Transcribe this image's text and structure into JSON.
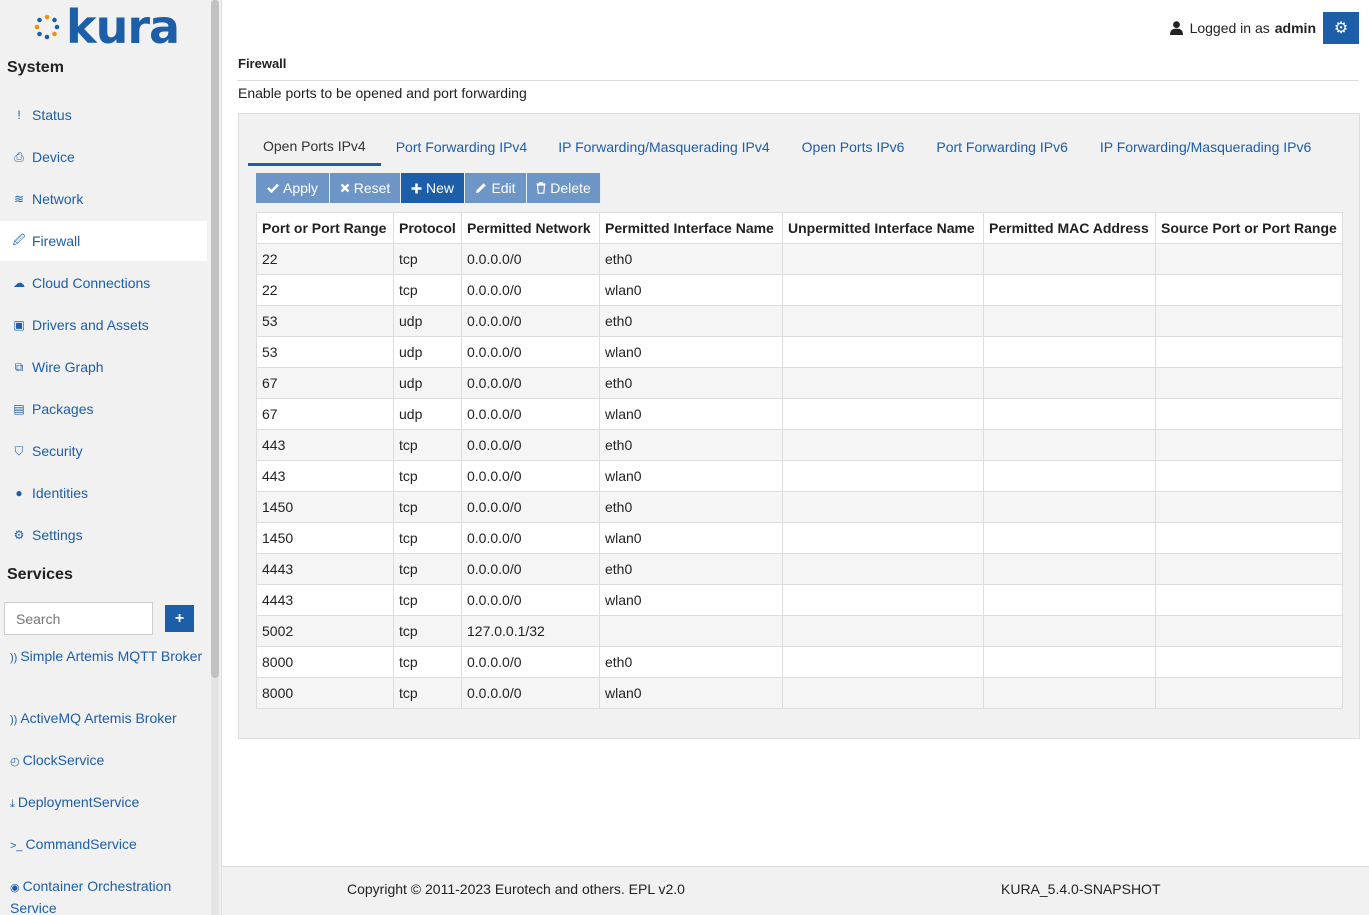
{
  "brand": {
    "logo_text": "kura"
  },
  "sidebar": {
    "system_title": "System",
    "system_items": [
      {
        "label": "Status",
        "icon": "exclamation-icon",
        "glyph": "!"
      },
      {
        "label": "Device",
        "icon": "printer-icon",
        "glyph": "⎙"
      },
      {
        "label": "Network",
        "icon": "wifi-icon",
        "glyph": "≋"
      },
      {
        "label": "Firewall",
        "icon": "fire-icon",
        "glyph": "🖉"
      },
      {
        "label": "Cloud Connections",
        "icon": "cloud-icon",
        "glyph": "☁"
      },
      {
        "label": "Drivers and Assets",
        "icon": "cube-icon",
        "glyph": "▣"
      },
      {
        "label": "Wire Graph",
        "icon": "sitemap-icon",
        "glyph": "⧉"
      },
      {
        "label": "Packages",
        "icon": "briefcase-icon",
        "glyph": "▤"
      },
      {
        "label": "Security",
        "icon": "shield-icon",
        "glyph": "⛉"
      },
      {
        "label": "Identities",
        "icon": "user-icon",
        "glyph": "●"
      },
      {
        "label": "Settings",
        "icon": "cog-icon",
        "glyph": "⚙"
      }
    ],
    "active_item": "Firewall",
    "services_title": "Services",
    "search_placeholder": "Search",
    "add_label": "+",
    "services": [
      {
        "label": "Simple Artemis MQTT Broker",
        "icon": "rss-icon",
        "glyph": "))"
      },
      {
        "label": "ActiveMQ Artemis Broker",
        "icon": "rss-icon",
        "glyph": "))"
      },
      {
        "label": "ClockService",
        "icon": "clock-icon",
        "glyph": "◴"
      },
      {
        "label": "DeploymentService",
        "icon": "download-icon",
        "glyph": "⤓"
      },
      {
        "label": "CommandService",
        "icon": "terminal-icon",
        "glyph": ">_"
      },
      {
        "label": "Container Orchestration Service",
        "icon": "docker-icon",
        "glyph": "◉"
      }
    ]
  },
  "header": {
    "logged_in_prefix": "Logged in as",
    "username": "admin",
    "settings_glyph": "⚙"
  },
  "main": {
    "title": "Firewall",
    "description": "Enable ports to be opened and port forwarding",
    "tabs": [
      "Open Ports IPv4",
      "Port Forwarding IPv4",
      "IP Forwarding/Masquerading IPv4",
      "Open Ports IPv6",
      "Port Forwarding IPv6",
      "IP Forwarding/Masquerading IPv6"
    ],
    "active_tab": "Open Ports IPv4",
    "toolbar": {
      "apply": "Apply",
      "reset": "Reset",
      "new": "New",
      "edit": "Edit",
      "delete": "Delete"
    },
    "table": {
      "columns": [
        "Port or Port Range",
        "Protocol",
        "Permitted Network",
        "Permitted Interface Name",
        "Unpermitted Interface Name",
        "Permitted MAC Address",
        "Source Port or Port Range"
      ],
      "rows": [
        [
          "22",
          "tcp",
          "0.0.0.0/0",
          "eth0",
          "",
          "",
          ""
        ],
        [
          "22",
          "tcp",
          "0.0.0.0/0",
          "wlan0",
          "",
          "",
          ""
        ],
        [
          "53",
          "udp",
          "0.0.0.0/0",
          "eth0",
          "",
          "",
          ""
        ],
        [
          "53",
          "udp",
          "0.0.0.0/0",
          "wlan0",
          "",
          "",
          ""
        ],
        [
          "67",
          "udp",
          "0.0.0.0/0",
          "eth0",
          "",
          "",
          ""
        ],
        [
          "67",
          "udp",
          "0.0.0.0/0",
          "wlan0",
          "",
          "",
          ""
        ],
        [
          "443",
          "tcp",
          "0.0.0.0/0",
          "eth0",
          "",
          "",
          ""
        ],
        [
          "443",
          "tcp",
          "0.0.0.0/0",
          "wlan0",
          "",
          "",
          ""
        ],
        [
          "1450",
          "tcp",
          "0.0.0.0/0",
          "eth0",
          "",
          "",
          ""
        ],
        [
          "1450",
          "tcp",
          "0.0.0.0/0",
          "wlan0",
          "",
          "",
          ""
        ],
        [
          "4443",
          "tcp",
          "0.0.0.0/0",
          "eth0",
          "",
          "",
          ""
        ],
        [
          "4443",
          "tcp",
          "0.0.0.0/0",
          "wlan0",
          "",
          "",
          ""
        ],
        [
          "5002",
          "tcp",
          "127.0.0.1/32",
          "",
          "",
          "",
          ""
        ],
        [
          "8000",
          "tcp",
          "0.0.0.0/0",
          "eth0",
          "",
          "",
          ""
        ],
        [
          "8000",
          "tcp",
          "0.0.0.0/0",
          "wlan0",
          "",
          "",
          ""
        ]
      ]
    }
  },
  "footer": {
    "copyright": "Copyright © 2011-2023 Eurotech and others. EPL v2.0",
    "version": "KURA_5.4.0-SNAPSHOT"
  },
  "colors": {
    "accent": "#1d5ea8",
    "disabled_button": "#6d96c7",
    "sidebar_bg": "#f1f1f1"
  }
}
